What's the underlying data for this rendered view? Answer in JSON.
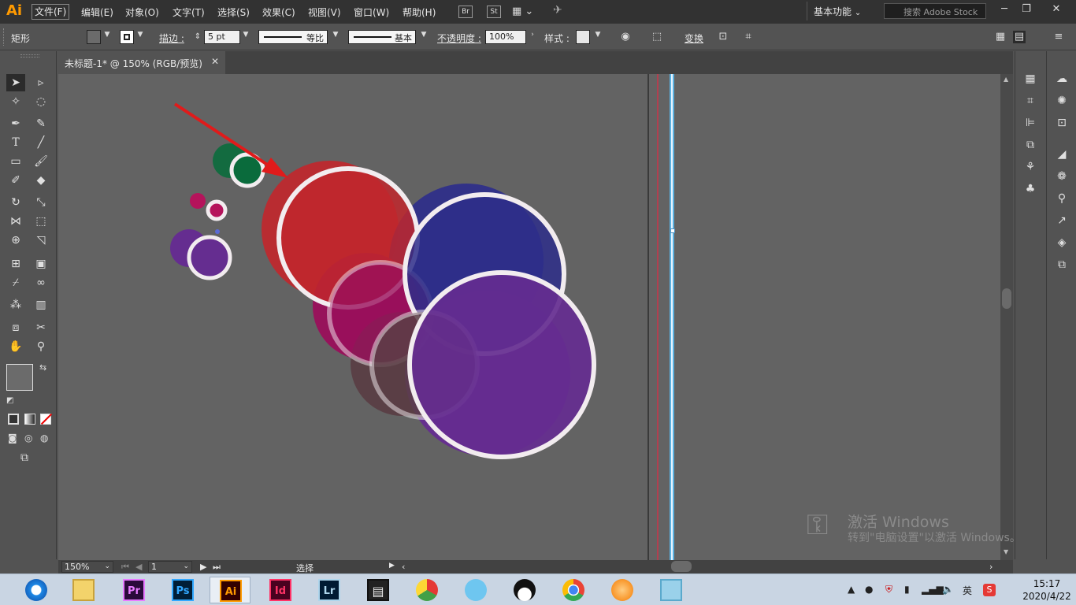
{
  "app": {
    "logo": "Ai",
    "menu": [
      "文件(F)",
      "编辑(E)",
      "对象(O)",
      "文字(T)",
      "选择(S)",
      "效果(C)",
      "视图(V)",
      "窗口(W)",
      "帮助(H)"
    ],
    "bridge_label": "Br",
    "stock_label": "St",
    "workspace": "基本功能",
    "search_placeholder": "搜索 Adobe Stock",
    "win_min": "─",
    "win_max": "❐",
    "win_close": "✕"
  },
  "control": {
    "selection_type": "矩形",
    "fill_color": "#6b6b6b",
    "stroke_label": "描边 :",
    "stroke_weight": "5 pt",
    "profile_label": "等比",
    "brush_label": "基本",
    "opacity_label": "不透明度 :",
    "opacity_value": "100%",
    "style_label": "样式 :",
    "transform_label": "变换"
  },
  "document": {
    "tab_title": "未标题-1* @ 150% (RGB/预览)",
    "tab_close": "✕"
  },
  "status": {
    "zoom": "150%",
    "page": "1",
    "tool_status": "选择"
  },
  "watermark": {
    "title": "激活 Windows",
    "subtitle": "转到\"电脑设置\"以激活 Windows。"
  },
  "taskbar": {
    "apps": [
      {
        "name": "ie",
        "label": ""
      },
      {
        "name": "explorer",
        "label": ""
      },
      {
        "name": "premiere",
        "label": "Pr",
        "color": "#e77bff",
        "bg": "#2a0a3a"
      },
      {
        "name": "photoshop",
        "label": "Ps",
        "color": "#31a8ff",
        "bg": "#001e36"
      },
      {
        "name": "illustrator",
        "label": "Ai",
        "color": "#ff9a00",
        "bg": "#330000"
      },
      {
        "name": "indesign",
        "label": "Id",
        "color": "#ff3366",
        "bg": "#49021f"
      },
      {
        "name": "lightroom",
        "label": "Lr",
        "color": "#add5ec",
        "bg": "#001a33"
      },
      {
        "name": "video-editor",
        "label": ""
      },
      {
        "name": "app-colorful",
        "label": ""
      },
      {
        "name": "app-rabbit",
        "label": ""
      },
      {
        "name": "qq",
        "label": ""
      },
      {
        "name": "chrome",
        "label": ""
      },
      {
        "name": "app-orange",
        "label": ""
      },
      {
        "name": "app-notes",
        "label": ""
      }
    ],
    "ime": "英",
    "time": "15:17",
    "date": "2020/4/22"
  },
  "colors": {
    "red": "#c0272d",
    "dark_blue": "#2e2e8a",
    "magenta": "#9a0f5b",
    "brown": "#5a3e45",
    "purple": "#652d90",
    "green": "#0a6b3c",
    "ring": "#f2ecef",
    "arrow": "#e01b1b"
  }
}
